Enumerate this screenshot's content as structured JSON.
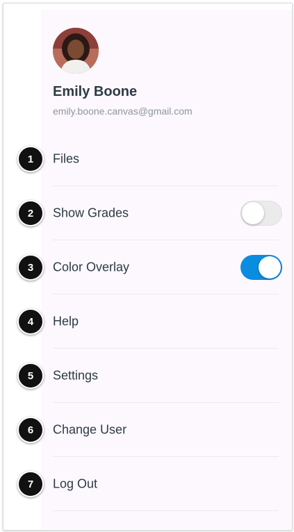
{
  "profile": {
    "name": "Emily Boone",
    "email": "emily.boone.canvas@gmail.com"
  },
  "menu": [
    {
      "number": "1",
      "label": "Files",
      "icon": "number-badge"
    },
    {
      "number": "2",
      "label": "Show Grades",
      "toggle": "off"
    },
    {
      "number": "3",
      "label": "Color Overlay",
      "toggle": "on"
    },
    {
      "number": "4",
      "label": "Help"
    },
    {
      "number": "5",
      "label": "Settings"
    },
    {
      "number": "6",
      "label": "Change User"
    },
    {
      "number": "7",
      "label": "Log Out"
    }
  ],
  "colors": {
    "toggle_on": "#0a8ce0",
    "text": "#2d3b45",
    "secondary_text": "#8b969e",
    "badge": "#111111"
  }
}
